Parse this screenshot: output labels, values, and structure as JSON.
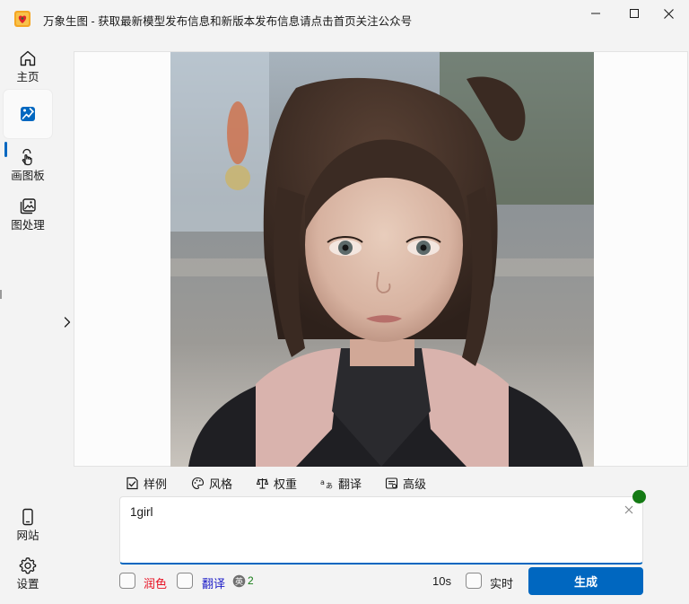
{
  "window": {
    "title": "万象生图  -  获取最新模型发布信息和新版本发布信息请点击首页关注公众号",
    "app_icon": "app-logo-icon",
    "controls": [
      "minimize-icon",
      "maximize-icon",
      "close-icon"
    ]
  },
  "sidebar": {
    "items": [
      {
        "label": "主页",
        "icon": "home-icon",
        "active": false
      },
      {
        "label": "",
        "icon": "image-edit-icon",
        "active": true
      },
      {
        "label": "画图板",
        "icon": "draw-board-icon",
        "active": false
      },
      {
        "label": "图处理",
        "icon": "image-process-icon",
        "active": false
      }
    ],
    "bottom_items": [
      {
        "label": "网站",
        "icon": "phone-icon"
      },
      {
        "label": "设置",
        "icon": "gear-icon"
      }
    ]
  },
  "option_tabs": [
    {
      "label": "样例",
      "icon": "sample-icon"
    },
    {
      "label": "风格",
      "icon": "palette-icon"
    },
    {
      "label": "权重",
      "icon": "balance-icon"
    },
    {
      "label": "翻译",
      "icon": "translate-icon"
    },
    {
      "label": "高级",
      "icon": "advanced-icon"
    }
  ],
  "prompt": {
    "value": "1girl",
    "status_color": "#147a14"
  },
  "bottom": {
    "polish_label": "润色",
    "polish_color": "#e81123",
    "translate_label": "翻译",
    "translate_color": "#2020c8",
    "badge_count": "2",
    "seconds": "10s",
    "realtime_label": "实时",
    "generate_label": "生成"
  },
  "colors": {
    "accent": "#0067c0",
    "background": "#f3f3f3"
  }
}
